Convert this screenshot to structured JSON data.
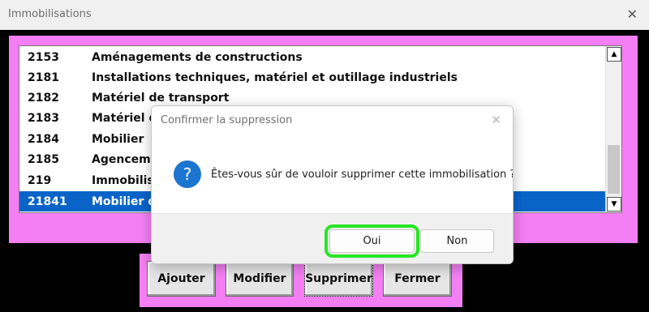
{
  "window": {
    "title": "Immobilisations",
    "close_glyph": "✕"
  },
  "list": {
    "rows": [
      {
        "code": "2153",
        "label": "Aménagements de constructions",
        "selected": false
      },
      {
        "code": "2181",
        "label": "Installations techniques, matériel et outillage industriels",
        "selected": false
      },
      {
        "code": "2182",
        "label": "Matériel de transport",
        "selected": false
      },
      {
        "code": "2183",
        "label": "Matériel de",
        "selected": false
      },
      {
        "code": "2184",
        "label": "Mobilier",
        "selected": false
      },
      {
        "code": "2185",
        "label": "Agenceme",
        "selected": false
      },
      {
        "code": "219",
        "label": "Immobilisa",
        "selected": false
      },
      {
        "code": "21841",
        "label": "Mobilier de",
        "selected": true
      }
    ],
    "scroll_up_glyph": "▲",
    "scroll_down_glyph": "▼"
  },
  "buttons": {
    "add": "Ajouter",
    "edit": "Modifier",
    "delete": "Supprimer",
    "close": "Fermer"
  },
  "dialog": {
    "title": "Confirmer la suppression",
    "close_glyph": "✕",
    "icon": "question-icon",
    "icon_glyph": "?",
    "message": "Êtes-vous sûr de vouloir supprimer cette immobilisation ?",
    "yes_label": "Oui",
    "no_label": "Non"
  },
  "colors": {
    "accent_pink": "#f47ff4",
    "selection_blue": "#0a64c8",
    "focus_green": "#27e625",
    "icon_blue": "#1c75cf"
  }
}
